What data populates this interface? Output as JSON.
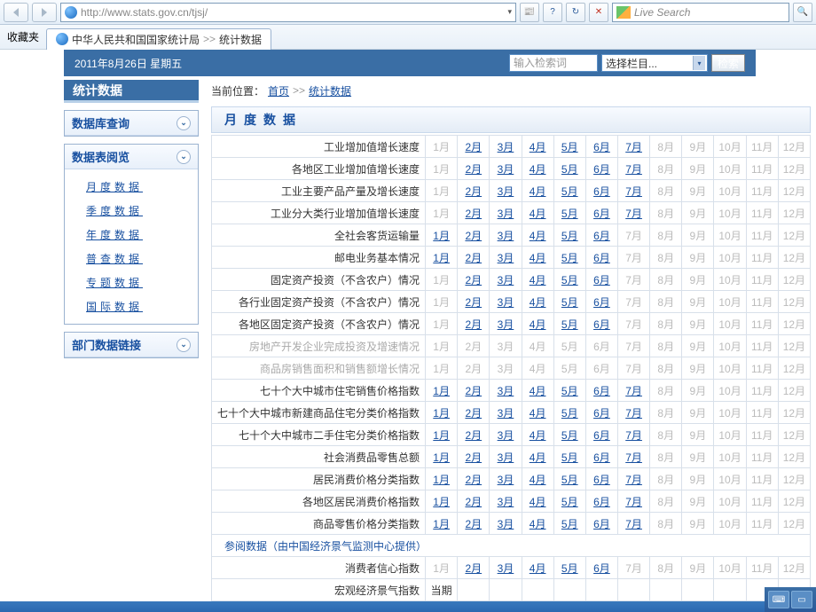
{
  "browser": {
    "url": "http://www.stats.gov.cn/tjsj/",
    "search_placeholder": "Live Search",
    "favorites_label": "收藏夹",
    "tab_title": "中华人民共和国国家统计局",
    "tab_sep": ">>",
    "tab_sub": "统计数据"
  },
  "header": {
    "date": "2011年8月26日 星期五",
    "search_placeholder": "输入检索词",
    "select_label": "选择栏目...",
    "search_btn": "检索"
  },
  "sidebar": {
    "title": "统计数据",
    "section1": {
      "title": "数据库查询"
    },
    "section2": {
      "title": "数据表阅览",
      "items": [
        "月度数据",
        "季度数据",
        "年度数据",
        "普查数据",
        "专题数据",
        "国际数据"
      ]
    },
    "section3": {
      "title": "部门数据链接"
    }
  },
  "breadcrumb": {
    "label": "当前位置：",
    "home": "首页",
    "sep": ">>",
    "current": "统计数据"
  },
  "section_title": "月度数据",
  "months": [
    "1月",
    "2月",
    "3月",
    "4月",
    "5月",
    "6月",
    "7月",
    "8月",
    "9月",
    "10月",
    "11月",
    "12月"
  ],
  "rows": [
    {
      "name": "工业增加值增长速度",
      "active": [
        0,
        1,
        1,
        1,
        1,
        1,
        1,
        0,
        0,
        0,
        0,
        0
      ],
      "disabled": false
    },
    {
      "name": "各地区工业增加值增长速度",
      "active": [
        0,
        1,
        1,
        1,
        1,
        1,
        1,
        0,
        0,
        0,
        0,
        0
      ],
      "disabled": false
    },
    {
      "name": "工业主要产品产量及增长速度",
      "active": [
        0,
        1,
        1,
        1,
        1,
        1,
        1,
        0,
        0,
        0,
        0,
        0
      ],
      "disabled": false
    },
    {
      "name": "工业分大类行业增加值增长速度",
      "active": [
        0,
        1,
        1,
        1,
        1,
        1,
        1,
        0,
        0,
        0,
        0,
        0
      ],
      "disabled": false
    },
    {
      "name": "全社会客货运输量",
      "active": [
        1,
        1,
        1,
        1,
        1,
        1,
        0,
        0,
        0,
        0,
        0,
        0
      ],
      "disabled": false
    },
    {
      "name": "邮电业务基本情况",
      "active": [
        1,
        1,
        1,
        1,
        1,
        1,
        0,
        0,
        0,
        0,
        0,
        0
      ],
      "disabled": false
    },
    {
      "name": "固定资产投资（不含农户）情况",
      "active": [
        0,
        1,
        1,
        1,
        1,
        1,
        0,
        0,
        0,
        0,
        0,
        0
      ],
      "disabled": false
    },
    {
      "name": "各行业固定资产投资（不含农户）情况",
      "active": [
        0,
        1,
        1,
        1,
        1,
        1,
        0,
        0,
        0,
        0,
        0,
        0
      ],
      "disabled": false
    },
    {
      "name": "各地区固定资产投资（不含农户）情况",
      "active": [
        0,
        1,
        1,
        1,
        1,
        1,
        0,
        0,
        0,
        0,
        0,
        0
      ],
      "disabled": false
    },
    {
      "name": "房地产开发企业完成投资及增速情况",
      "active": [
        0,
        0,
        0,
        0,
        0,
        0,
        0,
        0,
        0,
        0,
        0,
        0
      ],
      "disabled": true
    },
    {
      "name": "商品房销售面积和销售额增长情况",
      "active": [
        0,
        0,
        0,
        0,
        0,
        0,
        0,
        0,
        0,
        0,
        0,
        0
      ],
      "disabled": true
    },
    {
      "name": "七十个大中城市住宅销售价格指数",
      "active": [
        1,
        1,
        1,
        1,
        1,
        1,
        1,
        0,
        0,
        0,
        0,
        0
      ],
      "disabled": false
    },
    {
      "name": "七十个大中城市新建商品住宅分类价格指数",
      "active": [
        1,
        1,
        1,
        1,
        1,
        1,
        1,
        0,
        0,
        0,
        0,
        0
      ],
      "disabled": false
    },
    {
      "name": "七十个大中城市二手住宅分类价格指数",
      "active": [
        1,
        1,
        1,
        1,
        1,
        1,
        1,
        0,
        0,
        0,
        0,
        0
      ],
      "disabled": false
    },
    {
      "name": "社会消费品零售总额",
      "active": [
        1,
        1,
        1,
        1,
        1,
        1,
        1,
        0,
        0,
        0,
        0,
        0
      ],
      "disabled": false
    },
    {
      "name": "居民消费价格分类指数",
      "active": [
        1,
        1,
        1,
        1,
        1,
        1,
        1,
        0,
        0,
        0,
        0,
        0
      ],
      "disabled": false
    },
    {
      "name": "各地区居民消费价格指数",
      "active": [
        1,
        1,
        1,
        1,
        1,
        1,
        1,
        0,
        0,
        0,
        0,
        0
      ],
      "disabled": false
    },
    {
      "name": "商品零售价格分类指数",
      "active": [
        1,
        1,
        1,
        1,
        1,
        1,
        1,
        0,
        0,
        0,
        0,
        0
      ],
      "disabled": false
    }
  ],
  "reference_note": "参阅数据（由中国经济景气监测中心提供）",
  "rows2": [
    {
      "name": "消费者信心指数",
      "active": [
        0,
        1,
        1,
        1,
        1,
        1,
        0,
        0,
        0,
        0,
        0,
        0
      ],
      "disabled": false
    },
    {
      "name": "宏观经济景气指数",
      "period": "当期"
    }
  ]
}
